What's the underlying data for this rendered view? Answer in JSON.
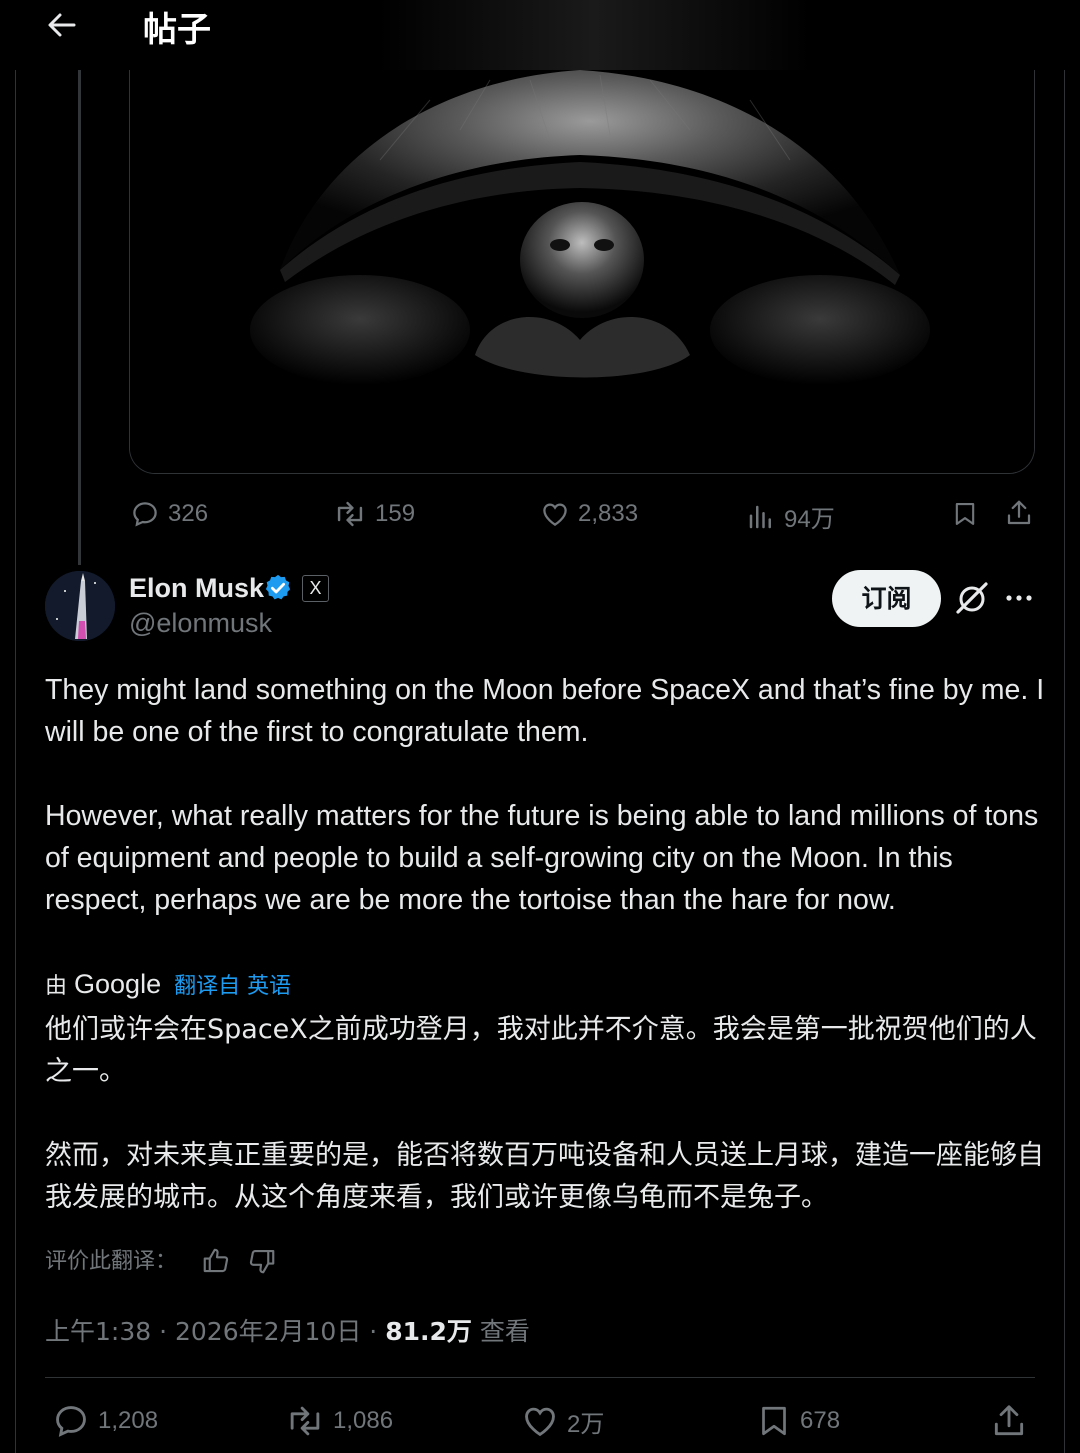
{
  "header": {
    "title": "帖子"
  },
  "parent_post": {
    "replies": "326",
    "reposts": "159",
    "likes": "2,833",
    "views": "94万"
  },
  "post": {
    "author_name": "Elon Musk",
    "affiliation_badge": "X",
    "handle": "@elonmusk",
    "subscribe_label": "订阅",
    "text_p1": "They might land something on the Moon before SpaceX and that’s fine by me. I will be one of the first to congratulate them.",
    "text_p2": "However, what really matters for the future is being able to land millions of tons of equipment and people to build a self-growing city on the Moon. In this respect, perhaps we are be more the tortoise than the hare for now.",
    "translation": {
      "by": "由",
      "provider": "Google",
      "link": "翻译自 英语",
      "zh_p1": "他们或许会在SpaceX之前成功登月，我对此并不介意。我会是第一批祝贺他们的人之一。",
      "zh_p2": "然而，对未来真正重要的是，能否将数百万吨设备和人员送上月球，建造一座能够自我发展的城市。从这个角度来看，我们或许更像乌龟而不是兔子。",
      "rate_label": "评价此翻译："
    },
    "time": "上午1:38",
    "date": "2026年2月10日",
    "sep": "·",
    "views_count": "81.2万",
    "views_label": "查看",
    "replies": "1,208",
    "reposts": "1,086",
    "likes": "2万",
    "bookmarks": "678"
  },
  "colors": {
    "accent": "#1d9bf0",
    "muted": "#71767b",
    "text": "#e7e9ea",
    "background": "#000000",
    "verified": "#1d9bf0"
  },
  "icons": [
    "back-arrow-icon",
    "reply-icon",
    "repost-icon",
    "like-icon",
    "views-icon",
    "bookmark-icon",
    "share-icon",
    "verified-icon",
    "grok-icon",
    "more-icon",
    "thumbs-up-icon",
    "thumbs-down-icon"
  ]
}
